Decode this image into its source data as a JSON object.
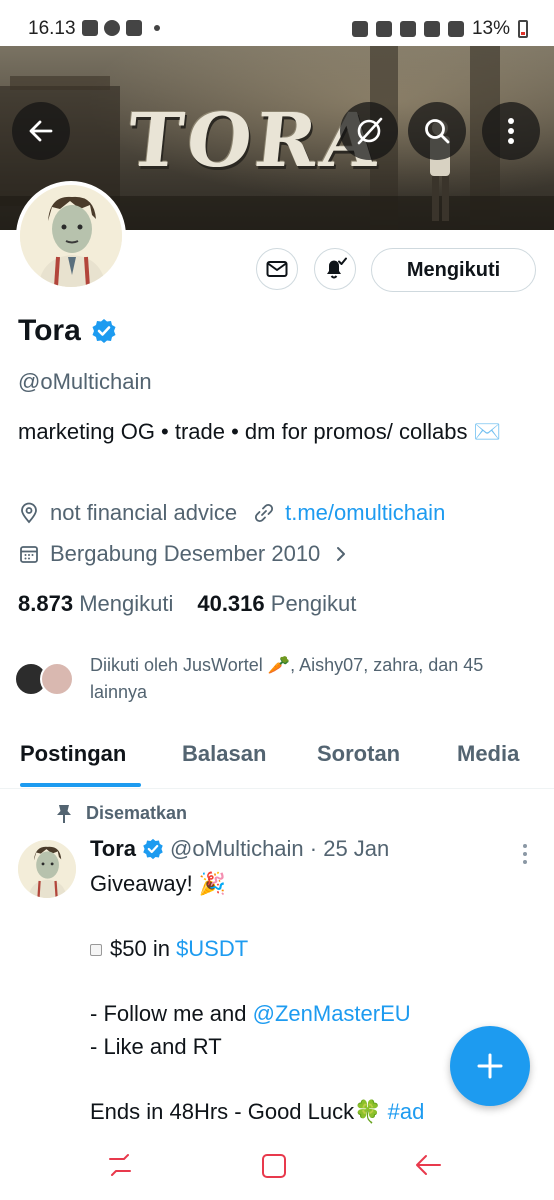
{
  "status_bar": {
    "time": "16.13",
    "battery": "13%"
  },
  "banner": {
    "title_art": "TORA"
  },
  "profile": {
    "name": "Tora",
    "handle": "@oMultichain",
    "bio": "marketing OG • trade • dm for promos/ collabs ✉️",
    "location": "not financial advice",
    "website": "t.me/omultichain",
    "joined": "Bergabung Desember 2010",
    "following_count": "8.873",
    "following_label": "Mengikuti",
    "followers_count": "40.316",
    "followers_label": "Pengikut",
    "followed_by": "Diikuti oleh JusWortel 🥕, Aishy07, zahra, dan 45 lainnya",
    "follow_button": "Mengikuti"
  },
  "tabs": [
    "Postingan",
    "Balasan",
    "Sorotan",
    "Media"
  ],
  "post": {
    "pinned_label": "Disematkan",
    "author": "Tora",
    "handle_time": "@oMultichain · 25 Jan",
    "line1": "Giveaway! 🎉",
    "line2_prefix": "$50 in ",
    "line2_link": "$USDT",
    "line3_prefix": "- Follow me and ",
    "line3_link": "@ZenMasterEU",
    "line4": "- Like and RT",
    "line5_prefix": "Ends in 48Hrs - Good Luck🍀 ",
    "line5_link": "#ad"
  },
  "colors": {
    "accent": "#1d9bf0",
    "secondary_text": "#536471"
  }
}
